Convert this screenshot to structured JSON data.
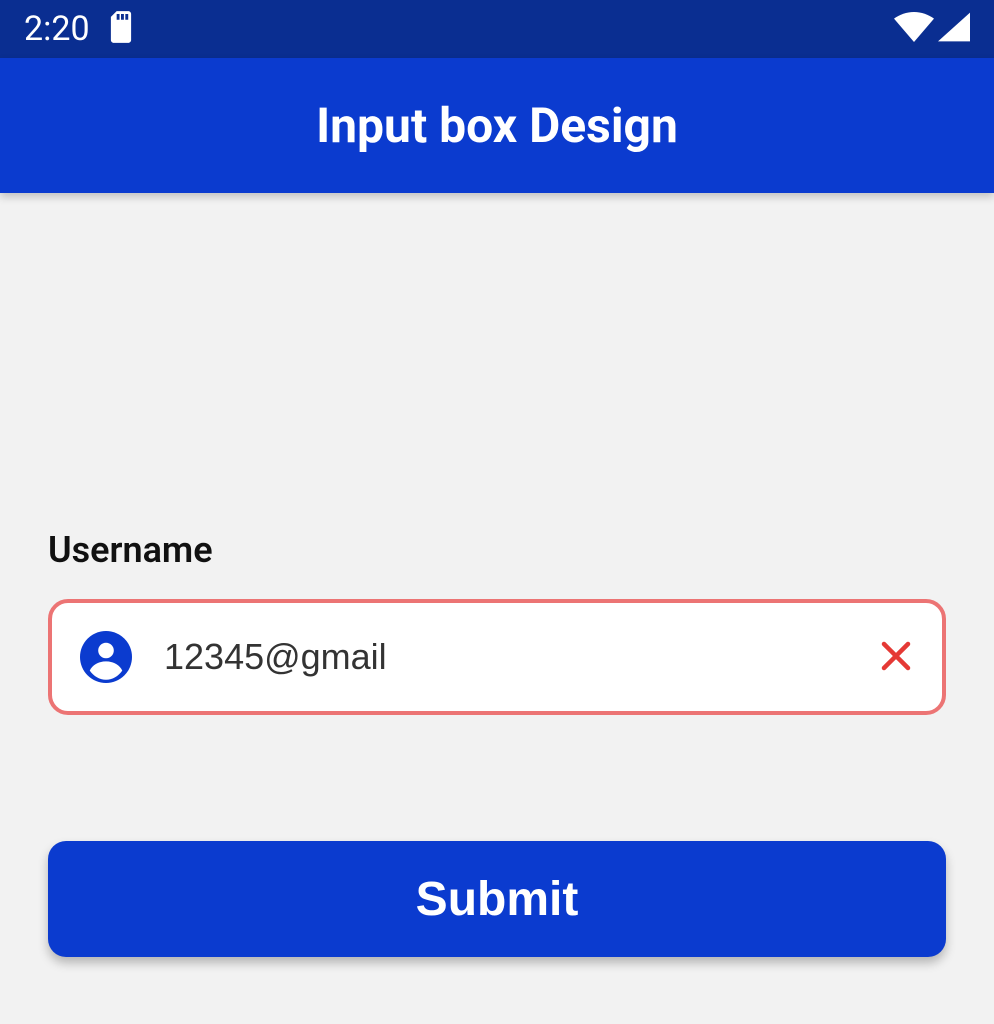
{
  "status_bar": {
    "time": "2:20"
  },
  "app_bar": {
    "title": "Input box Design"
  },
  "form": {
    "username_label": "Username",
    "username_value": "12345@gmail",
    "submit_label": "Submit"
  },
  "colors": {
    "primary": "#0b3bcf",
    "status_bar": "#0a2e91",
    "error_border": "#ec7474",
    "error_x": "#e53935"
  }
}
